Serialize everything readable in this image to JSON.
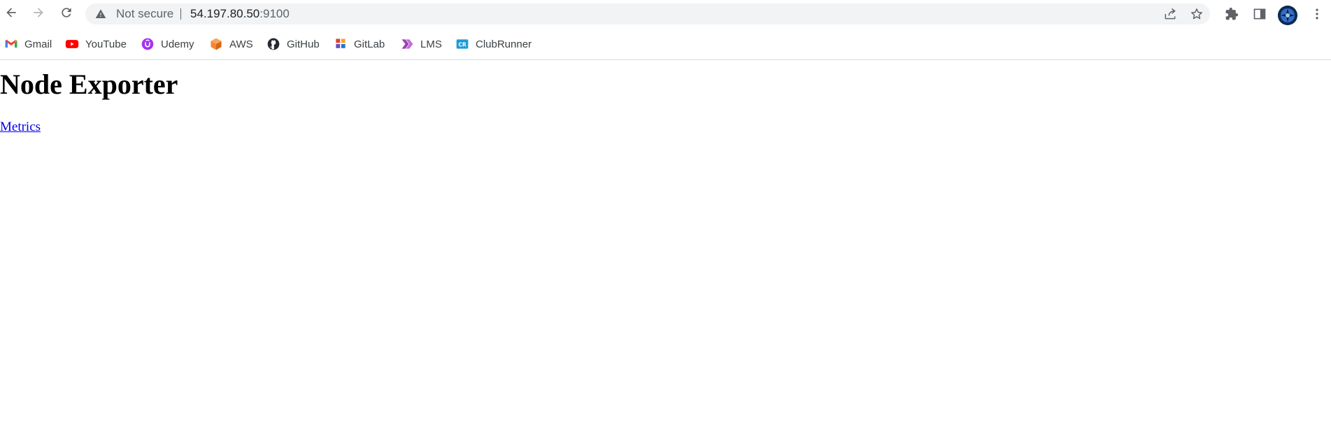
{
  "browser": {
    "security_label": "Not secure",
    "url_host": "54.197.80.50",
    "url_port": ":9100",
    "icons": {
      "back": "back-arrow-icon",
      "forward": "forward-arrow-icon",
      "reload": "reload-icon",
      "warning": "warning-icon",
      "share": "share-icon",
      "bookmark_star": "star-icon",
      "extensions": "puzzle-icon",
      "side_panel": "side-panel-icon",
      "menu": "kebab-menu-icon"
    }
  },
  "bookmarks": [
    {
      "label": "Gmail",
      "icon": "gmail-icon",
      "color": "#EA4335"
    },
    {
      "label": "YouTube",
      "icon": "youtube-icon",
      "color": "#FF0000"
    },
    {
      "label": "Udemy",
      "icon": "udemy-icon",
      "color": "#A435F0"
    },
    {
      "label": "AWS",
      "icon": "aws-icon",
      "color": "#F58536"
    },
    {
      "label": "GitHub",
      "icon": "github-icon",
      "color": "#24292F"
    },
    {
      "label": "GitLab",
      "icon": "gitlab-icon",
      "color": "#E24329"
    },
    {
      "label": "LMS",
      "icon": "lms-icon",
      "color": "#9C3FB3"
    },
    {
      "label": "ClubRunner",
      "icon": "clubrunner-icon",
      "color": "#1E9BD7"
    }
  ],
  "page": {
    "title": "Node Exporter",
    "link_label": "Metrics"
  },
  "colors": {
    "link": "#0000EE",
    "omnibox_bg": "#F1F3F4",
    "text": "#202124"
  }
}
